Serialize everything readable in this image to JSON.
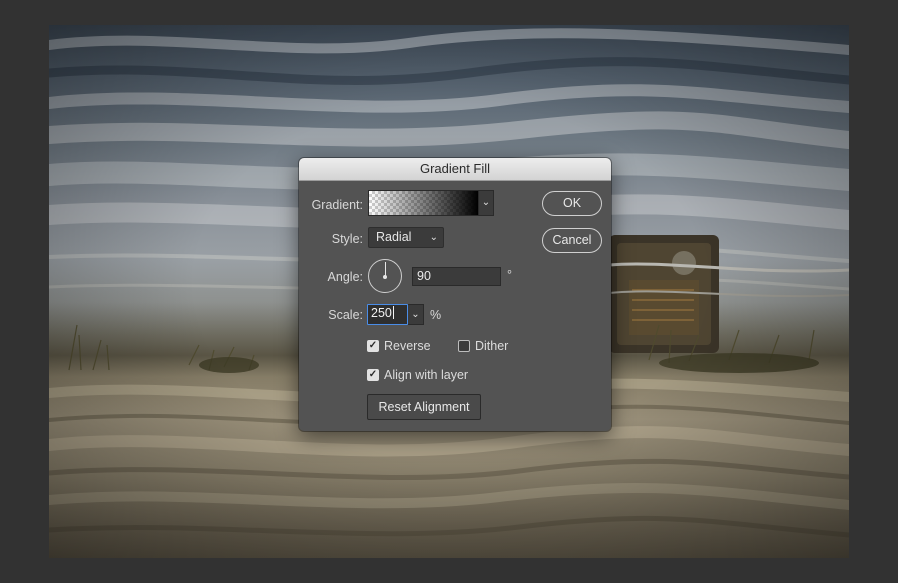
{
  "dialog": {
    "title": "Gradient Fill",
    "gradient_label": "Gradient:",
    "style_label": "Style:",
    "style_value": "Radial",
    "angle_label": "Angle:",
    "angle_value": "90",
    "angle_unit": "°",
    "scale_label": "Scale:",
    "scale_value": "250",
    "scale_unit": "%",
    "reverse_label": "Reverse",
    "reverse_checked": true,
    "dither_label": "Dither",
    "dither_checked": false,
    "align_label": "Align with layer",
    "align_checked": true,
    "reset_label": "Reset Alignment",
    "ok_label": "OK",
    "cancel_label": "Cancel",
    "check_glyph": "✓",
    "chevron_glyph": "⌄"
  },
  "icons": {
    "dropdown": "chevron-down-icon",
    "angle": "angle-dial-icon"
  },
  "colors": {
    "workspace_bg": "#323232",
    "dialog_bg": "#535353",
    "titlebar_bg": "#dcdcdc",
    "focus_ring": "#4a8de8"
  }
}
